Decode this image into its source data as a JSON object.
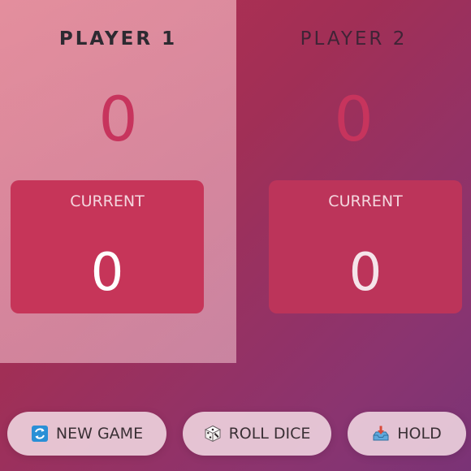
{
  "players": [
    {
      "name": "PLAYER 1",
      "score": "0",
      "current_label": "CURRENT",
      "current_score": "0",
      "active": true
    },
    {
      "name": "PLAYER 2",
      "score": "0",
      "current_label": "CURRENT",
      "current_score": "0",
      "active": false
    }
  ],
  "buttons": {
    "new_game": {
      "label": "NEW GAME",
      "icon": "refresh-icon"
    },
    "roll_dice": {
      "label": "ROLL DICE",
      "icon": "dice-icon"
    },
    "hold": {
      "label": "HOLD",
      "icon": "inbox-tray-icon"
    }
  },
  "colors": {
    "accent": "#c7345d",
    "current_box": "#c63559"
  }
}
